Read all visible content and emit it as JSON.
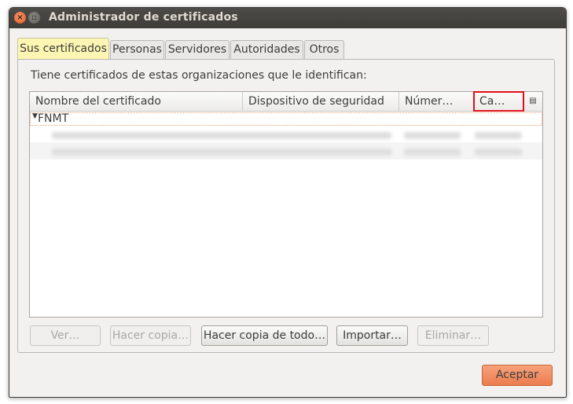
{
  "window": {
    "title": "Administrador de certificados"
  },
  "tabs": [
    {
      "label": "Sus certificados",
      "active": true
    },
    {
      "label": "Personas",
      "active": false
    },
    {
      "label": "Servidores",
      "active": false
    },
    {
      "label": "Autoridades",
      "active": false
    },
    {
      "label": "Otros",
      "active": false
    }
  ],
  "intro_text": "Tiene certificados de estas organizaciones que le identifican:",
  "table": {
    "columns": [
      "Nombre del certificado",
      "Dispositivo de seguridad",
      "Númer…",
      "Ca…"
    ],
    "group": "FNMT"
  },
  "buttons": {
    "view": "Ver…",
    "backup": "Hacer copia…",
    "backup_all": "Hacer copia de todo…",
    "import": "Importar…",
    "delete": "Eliminar…",
    "accept": "Aceptar"
  },
  "colors": {
    "accent": "#ec7d4e",
    "highlight_box": "#e0101a",
    "active_tab": "#fdf6b2"
  },
  "icons": {
    "close": "close-icon",
    "maximize": "maximize-icon",
    "column_picker": "column-picker-icon",
    "twisty": "expand-triangle-icon"
  }
}
